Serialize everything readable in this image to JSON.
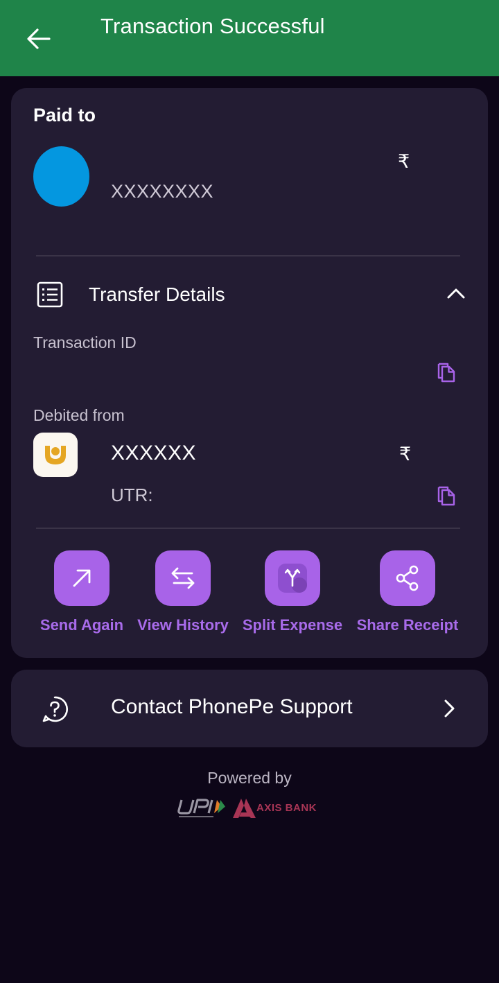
{
  "header": {
    "title": "Transaction Successful",
    "back_icon": "arrow-left-icon",
    "background_color": "#1f8449"
  },
  "paid_to": {
    "label": "Paid to",
    "payee_name": "XXXXXXXX",
    "currency_symbol": "₹",
    "avatar_color": "#0497e0"
  },
  "transfer_details": {
    "title": "Transfer Details",
    "transaction_id_label": "Transaction ID",
    "debited_from_label": "Debited from",
    "account": "XXXXXX",
    "currency_symbol": "₹",
    "utr_label": "UTR:"
  },
  "actions": [
    {
      "label": "Send Again",
      "icon": "arrow-up-right-icon"
    },
    {
      "label": "View History",
      "icon": "arrows-exchange-icon"
    },
    {
      "label": "Split Expense",
      "icon": "split-icon"
    },
    {
      "label": "Share Receipt",
      "icon": "share-icon"
    }
  ],
  "support": {
    "label": "Contact PhonePe Support",
    "icon": "help-circle-icon"
  },
  "footer": {
    "powered_by": "Powered by",
    "bank_name": "AXIS BANK",
    "upi_logo": "upi-logo"
  },
  "colors": {
    "accent": "#a863e8",
    "card_bg": "#231c33",
    "page_bg": "#0d0618"
  }
}
